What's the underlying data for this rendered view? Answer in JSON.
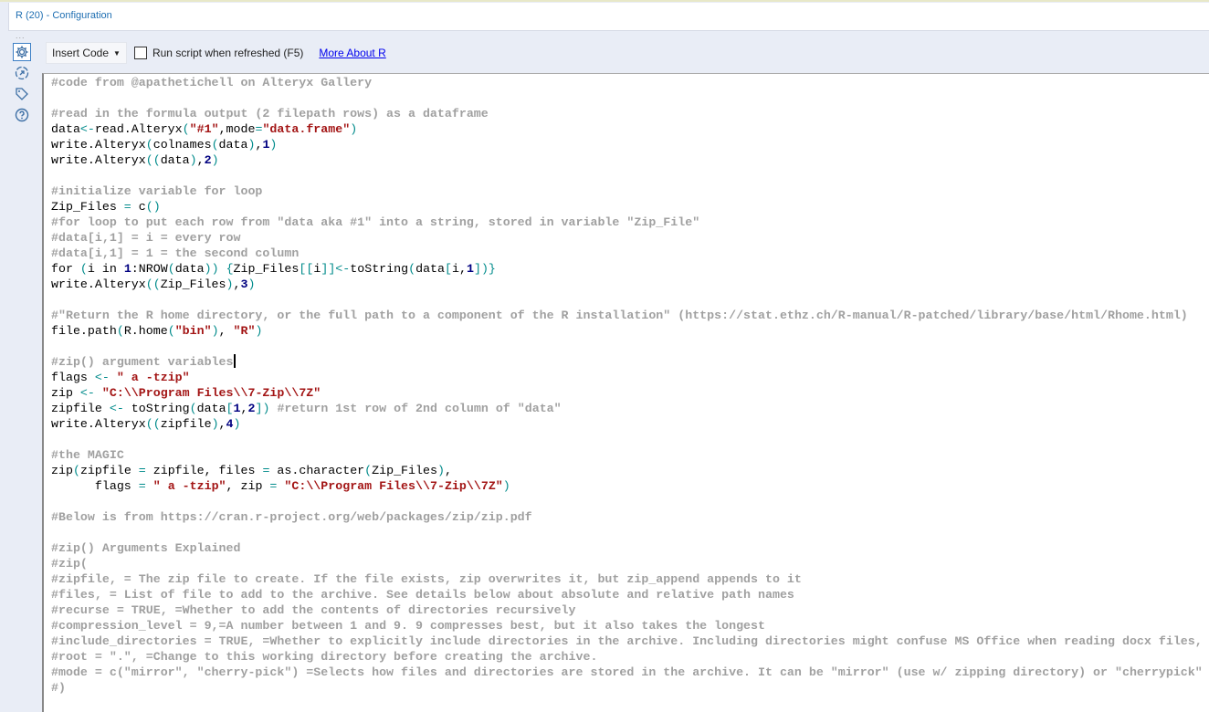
{
  "window": {
    "title": "R (20) - Configuration"
  },
  "sidebar": {
    "dots": "...",
    "icons": [
      "gear-icon",
      "connection-icon",
      "tag-icon",
      "help-icon"
    ]
  },
  "toolbar": {
    "insert_code_label": "Insert Code",
    "run_script_label": "Run script when refreshed (F5)",
    "run_script_checked": false,
    "more_about_label": "More About R"
  },
  "editor": {
    "cursor_line": 18,
    "lines": [
      "#code from @apathetichell on Alteryx Gallery",
      "",
      "#read in the formula output (2 filepath rows) as a dataframe",
      "data<-read.Alteryx(\"#1\",mode=\"data.frame\")",
      "write.Alteryx(colnames(data),1)",
      "write.Alteryx((data),2)",
      "",
      "#initialize variable for loop",
      "Zip_Files = c()",
      "#for loop to put each row from \"data aka #1\" into a string, stored in variable \"Zip_File\"",
      "#data[i,1] = i = every row",
      "#data[i,1] = 1 = the second column",
      "for (i in 1:NROW(data)) {Zip_Files[[i]]<-toString(data[i,1])}",
      "write.Alteryx((Zip_Files),3)",
      "",
      "#\"Return the R home directory, or the full path to a component of the R installation\" (https://stat.ethz.ch/R-manual/R-patched/library/base/html/Rhome.html)",
      "file.path(R.home(\"bin\"), \"R\")",
      "",
      "#zip() argument variables",
      "flags <- \" a -tzip\"",
      "zip <- \"C:\\\\Program Files\\\\7-Zip\\\\7Z\"",
      "zipfile <- toString(data[1,2]) #return 1st row of 2nd column of \"data\"",
      "write.Alteryx((zipfile),4)",
      "",
      "#the MAGIC",
      "zip(zipfile = zipfile, files = as.character(Zip_Files),",
      "      flags = \" a -tzip\", zip = \"C:\\\\Program Files\\\\7-Zip\\\\7Z\")",
      "",
      "#Below is from https://cran.r-project.org/web/packages/zip/zip.pdf",
      "",
      "#zip() Arguments Explained",
      "#zip(",
      "#zipfile, = The zip file to create. If the file exists, zip overwrites it, but zip_append appends to it",
      "#files, = List of file to add to the archive. See details below about absolute and relative path names",
      "#recurse = TRUE, =Whether to add the contents of directories recursively",
      "#compression_level = 9,=A number between 1 and 9. 9 compresses best, but it also takes the longest",
      "#include_directories = TRUE, =Whether to explicitly include directories in the archive. Including directories might confuse MS Office when reading docx files,",
      "#root = \".\", =Change to this working directory before creating the archive.",
      "#mode = c(\"mirror\", \"cherry-pick\") =Selects how files and directories are stored in the archive. It can be \"mirror\" (use w/ zipping directory) or \"cherrypick\"",
      "#)"
    ]
  }
}
